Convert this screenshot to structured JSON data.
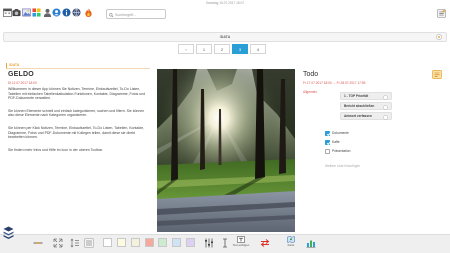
{
  "header": {
    "datetime": "Samstag 15.07.2017 18:07",
    "search_placeholder": "Suchbegriff...",
    "icons": [
      "calendar-icon",
      "camera-icon",
      "photo-icon",
      "apps-icon",
      "contacts-icon",
      "user-icon",
      "info-icon",
      "globe-icon",
      "fire-icon",
      "settings-icon"
    ]
  },
  "pathbar": {
    "path": "/DATA"
  },
  "pagination": {
    "prev": "‹",
    "pages": [
      "1",
      "2",
      "3",
      "4"
    ],
    "current_page": 3
  },
  "note": {
    "path": "/DATA",
    "title": "GELDO",
    "date": "Di 12.07.2017 18:00",
    "paragraphs": [
      "Willkommen in dieser App können Sie Notizen, Termine, Einkaufszettel, To-Do Listen, Tabellen mit einfachen Tabellenkalkulation-Funktionen, Kontakte, Diagramme, Fotos und PDF-Dokumente verwalten.",
      "Sie können Elemente schnell und einfach kategorisieren, suchen und filtern. Sie können also diese Elemente nach Kategorien organisieren.",
      "Sie können per Klick Notizen, Termine, Einkaufszettel, To-Do Listen, Tabellen, Kontakte, Diagramme, Fotos und PDF-Dokumente mit Kollegen teilen, damit diese sie direkt bearbeiten können.",
      "Sie finden mehr Infos und Hilfe im Icon in der oberen Toolbar."
    ]
  },
  "todo": {
    "title": "Todo",
    "date": "Fr 17.07.2017 18:00 → Fr 28.07.2017 17:59",
    "category": "Allgemein",
    "tasks": [
      {
        "label": "1 - TOP Priorität"
      },
      {
        "label": "Bericht abschließen"
      },
      {
        "label": "Antwort verfassen"
      }
    ],
    "checklist": [
      {
        "label": "Dokumente",
        "checked": true
      },
      {
        "label": "Kaffe",
        "checked": true
      },
      {
        "label": "Präsentation",
        "checked": false
      }
    ],
    "add_list": "Weitere Liste hinzufügen"
  },
  "bottom_toolbar": {
    "swatches": [
      "#ffffff",
      "#fffbe0",
      "#f4f1dc",
      "#f6a99b",
      "#cdeccf",
      "#cfe3f5",
      "#dcd0f3"
    ],
    "text_insert_label": "Text einfügen",
    "map_label": "Karte"
  },
  "colors": {
    "accent": "#2a9fd6",
    "date_red": "#d9534f",
    "path_orange": "#e8a33c"
  }
}
